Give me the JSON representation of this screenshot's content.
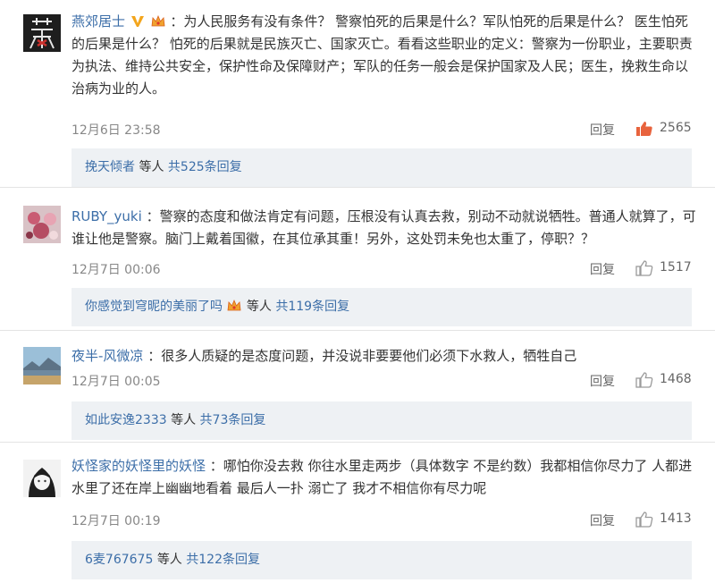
{
  "comments": [
    {
      "username": "燕郊居士",
      "text": "：为人民服务有没有条件？ 警察怕死的后果是什么？军队怕死的后果是什么？ 医生怕死的后果是什么？ 怕死的后果就是民族灭亡、国家灭亡。看看这些职业的定义：警察为一份职业，主要职责为执法、维持公共安全，保护性命及保障财产；军队的任务一般会是保护国家及人民；医生，挽救生命以治病为业的人。",
      "time": "12月6日 23:58",
      "reply": "回复",
      "likes": "2565",
      "like_active": true,
      "sub_user": "挽天倾者",
      "sub_suffix": "等人",
      "sub_total": "共525条回复"
    },
    {
      "username": "RUBY_yuki",
      "text": "：警察的态度和做法肯定有问题，压根没有认真去救，别动不动就说牺牲。普通人就算了，可谁让他是警察。脑门上戴着国徽，在其位承其重！另外，这处罚未免也太重了，停职？？",
      "time": "12月7日 00:06",
      "reply": "回复",
      "likes": "1517",
      "like_active": false,
      "sub_user": "你感觉到穹昵的美丽了吗",
      "sub_suffix": "等人",
      "sub_total": "共119条回复"
    },
    {
      "username": "夜半-风微凉",
      "text": "：很多人质疑的是态度问题，并没说非要要他们必须下水救人，牺牲自己",
      "time": "12月7日 00:05",
      "reply": "回复",
      "likes": "1468",
      "like_active": false,
      "sub_user": "如此安逸2333",
      "sub_suffix": "等人",
      "sub_total": "共73条回复"
    },
    {
      "username": "妖怪家的妖怪里的妖怪",
      "text": "：哪怕你没去救 你往水里走两步（具体数字 不是约数）我都相信你尽力了 人都进水里了还在岸上幽幽地看着 最后人一扑 溺亡了 我才不相信你有尽力呢",
      "time": "12月7日 00:19",
      "reply": "回复",
      "likes": "1413",
      "like_active": false,
      "sub_user": "6麦767675",
      "sub_suffix": "等人",
      "sub_total": "共122条回复"
    }
  ],
  "icons": {
    "verified": "v-verified-icon",
    "crown": "crown-badge-icon",
    "thumbs_up": "thumbs-up-icon"
  },
  "colors": {
    "link": "#3c6ea8",
    "like_active": "#e8633d",
    "like_inactive": "#9a9a9a",
    "verified": "#f3a51b",
    "sub_background": "#eef1f4"
  }
}
